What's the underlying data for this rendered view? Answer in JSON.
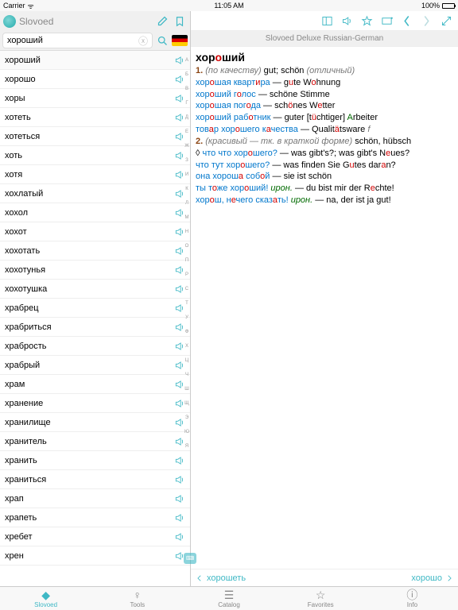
{
  "status": {
    "carrier": "Carrier",
    "wifi": "ᯤ",
    "time": "11:05 AM",
    "pct": "100%"
  },
  "header": {
    "title": "Slovoed"
  },
  "search": {
    "value": "хороший"
  },
  "words": [
    "хороший",
    "хорошо",
    "хоры",
    "хотеть",
    "хотеться",
    "хоть",
    "хотя",
    "хохлатый",
    "хохол",
    "хохот",
    "хохотать",
    "хохотунья",
    "хохотушка",
    "храбрец",
    "храбриться",
    "храбрость",
    "храбрый",
    "храм",
    "хранение",
    "хранилище",
    "хранитель",
    "хранить",
    "храниться",
    "храп",
    "храпеть",
    "хребет",
    "хрен"
  ],
  "index": [
    "А",
    "Б",
    "В",
    "Г",
    "Д",
    "Е",
    "Ж",
    "З",
    "И",
    "К",
    "Л",
    "М",
    "Н",
    "О",
    "П",
    "Р",
    "С",
    "Т",
    "У",
    "Ф",
    "Х",
    "Ц",
    "Ч",
    "Ш",
    "Щ",
    "Э",
    "Ю",
    "Я"
  ],
  "dict": {
    "name": "Slovoed Deluxe Russian-German"
  },
  "article": {
    "headword": "хороший",
    "l1_num": "1.",
    "l1_gram": "(по качеству)",
    "l1_tr": "gut; schön",
    "l1_tr2": "(отличный)",
    "ex1_ru1": "хор",
    "ex1_s1": "о",
    "ex1_ru2": "шая кварт",
    "ex1_s2": "и",
    "ex1_ru3": "ра",
    "ex1_de1": "g",
    "ex1_dh": "u",
    "ex1_de2": "te W",
    "ex1_dh2": "o",
    "ex1_de3": "hnung",
    "ex2_ru1": "хор",
    "ex2_s1": "о",
    "ex2_ru2": "ший г",
    "ex2_s2": "о",
    "ex2_ru3": "лос",
    "ex2_de": "schöne Stimme",
    "ex3_ru1": "хор",
    "ex3_s1": "о",
    "ex3_ru2": "шая пог",
    "ex3_s2": "о",
    "ex3_ru3": "да",
    "ex3_de1": "sch",
    "ex3_dh": "ö",
    "ex3_de2": "nes W",
    "ex3_dh2": "e",
    "ex3_de3": "tter",
    "ex4_ru1": "хор",
    "ex4_s1": "о",
    "ex4_ru2": "ший раб",
    "ex4_s2": "о",
    "ex4_ru3": "тник",
    "ex4_de1": "guter [t",
    "ex4_dh": "ü",
    "ex4_de2": "chtiger] ",
    "ex4_dt": "A",
    "ex4_de3": "rbeiter",
    "ex5_ru1": "тов",
    "ex5_s1": "а",
    "ex5_ru2": "р хор",
    "ex5_s2": "о",
    "ex5_ru3": "шего к",
    "ex5_s3": "а",
    "ex5_ru4": "чества",
    "ex5_de1": "Qualit",
    "ex5_dh": "ä",
    "ex5_de2": "tsware",
    "ex5_g": " f",
    "l2_num": "2.",
    "l2_gram": "(красивый — тк. в краткой форме)",
    "l2_tr": "schön, hübsch",
    "ex6_lead": "◊ ",
    "ex6_ru1": "что хор",
    "ex6_s1": "о",
    "ex6_ru2": "шего?",
    "ex6_de1": "was gibt's?; was gibt's N",
    "ex6_dh": "e",
    "ex6_de2": "ues?",
    "ex7_ru1": "что тут хор",
    "ex7_s1": "о",
    "ex7_ru2": "шего?",
    "ex7_de1": "was finden Sie G",
    "ex7_dh": "u",
    "ex7_de2": "tes dar",
    "ex7_dh2": "a",
    "ex7_de3": "n?",
    "ex8_ru1": "она хорош",
    "ex8_s1": "а",
    "ex8_ru2": " соб",
    "ex8_s2": "о",
    "ex8_ru3": "й",
    "ex8_de": "sie ist schön",
    "ex9_ru1": "ты т",
    "ex9_s1": "о",
    "ex9_ru2": "же хор",
    "ex9_s2": "о",
    "ex9_ru3": "ший!",
    "ex9_g": " ирон.",
    "ex9_de1": "du bist mir der R",
    "ex9_dh": "e",
    "ex9_de2": "chte!",
    "ex10_ru1": "хор",
    "ex10_s1": "о",
    "ex10_ru2": "ш, н",
    "ex10_s2": "е",
    "ex10_ru3": "чего сказ",
    "ex10_s3": "а",
    "ex10_ru4": "ть!",
    "ex10_g": " ирон.",
    "ex10_de": "na, der ist ja gut!"
  },
  "nav": {
    "prev": "хорошеть",
    "next": "хорошо"
  },
  "tabs": {
    "t1": "Slovoed",
    "t2": "Tools",
    "t3": "Catalog",
    "t4": "Favorites",
    "t5": "Info"
  }
}
